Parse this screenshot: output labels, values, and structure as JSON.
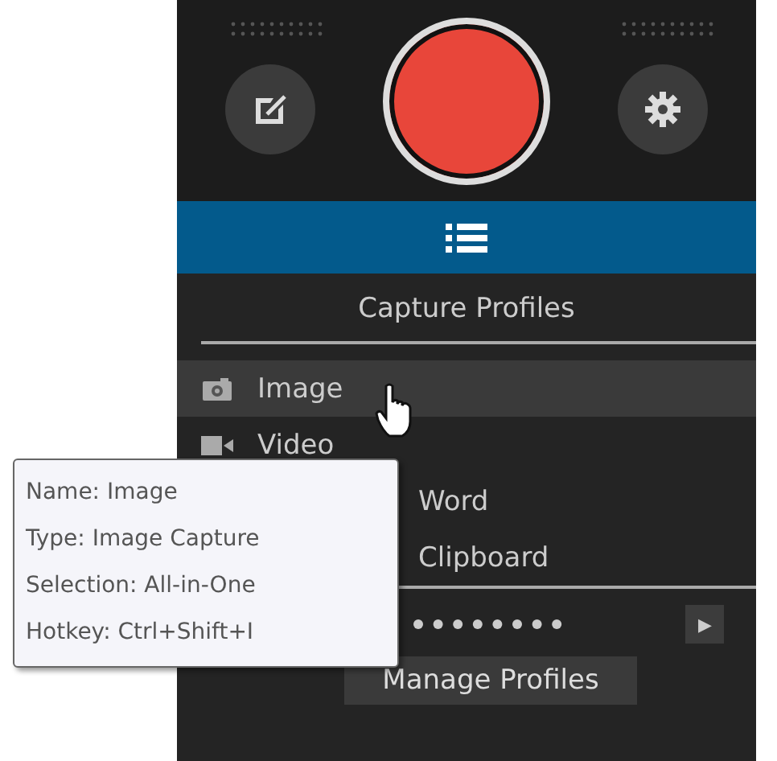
{
  "toolbar": {
    "list_button_selected": true
  },
  "title": "Capture Profiles",
  "profiles": [
    {
      "label": "Image",
      "kind": "camera",
      "selected": true
    },
    {
      "label": "Video",
      "kind": "video",
      "selected": false
    },
    {
      "label": "Word",
      "selected": false
    },
    {
      "label": "Clipboard",
      "selected": false
    }
  ],
  "play_button": "▶",
  "manage_button": "Manage Profiles",
  "tooltip": [
    "Name: Image",
    "Type: Image Capture",
    "Selection: All-in-One",
    "Hotkey: Ctrl+Shift+I"
  ]
}
